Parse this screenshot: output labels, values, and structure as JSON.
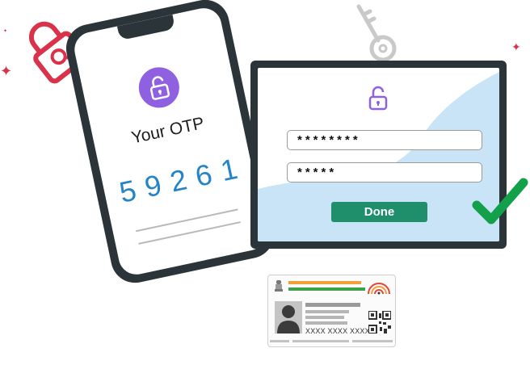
{
  "phone": {
    "title": "Your OTP",
    "otp_code": "59261"
  },
  "login_panel": {
    "password_field_1": "********",
    "password_field_2": "*****",
    "done_label": "Done"
  },
  "id_card": {
    "number": "XXXX XXXX XXXX"
  },
  "icons": [
    "padlock-search-icon",
    "key-icon",
    "unlock-icon",
    "checkmark-icon",
    "sparkle-icon",
    "emblem-icon",
    "qr-code-icon",
    "fingerprint-logo-icon",
    "person-photo-icon"
  ],
  "colors": {
    "accent_purple": "#8f61e0",
    "otp_blue": "#2583c8",
    "done_green": "#1f8e6a",
    "check_green": "#12a14a",
    "padlock_red": "#d9324a",
    "device_dark": "#2b3438",
    "blob_blue": "#c9e4f7"
  }
}
